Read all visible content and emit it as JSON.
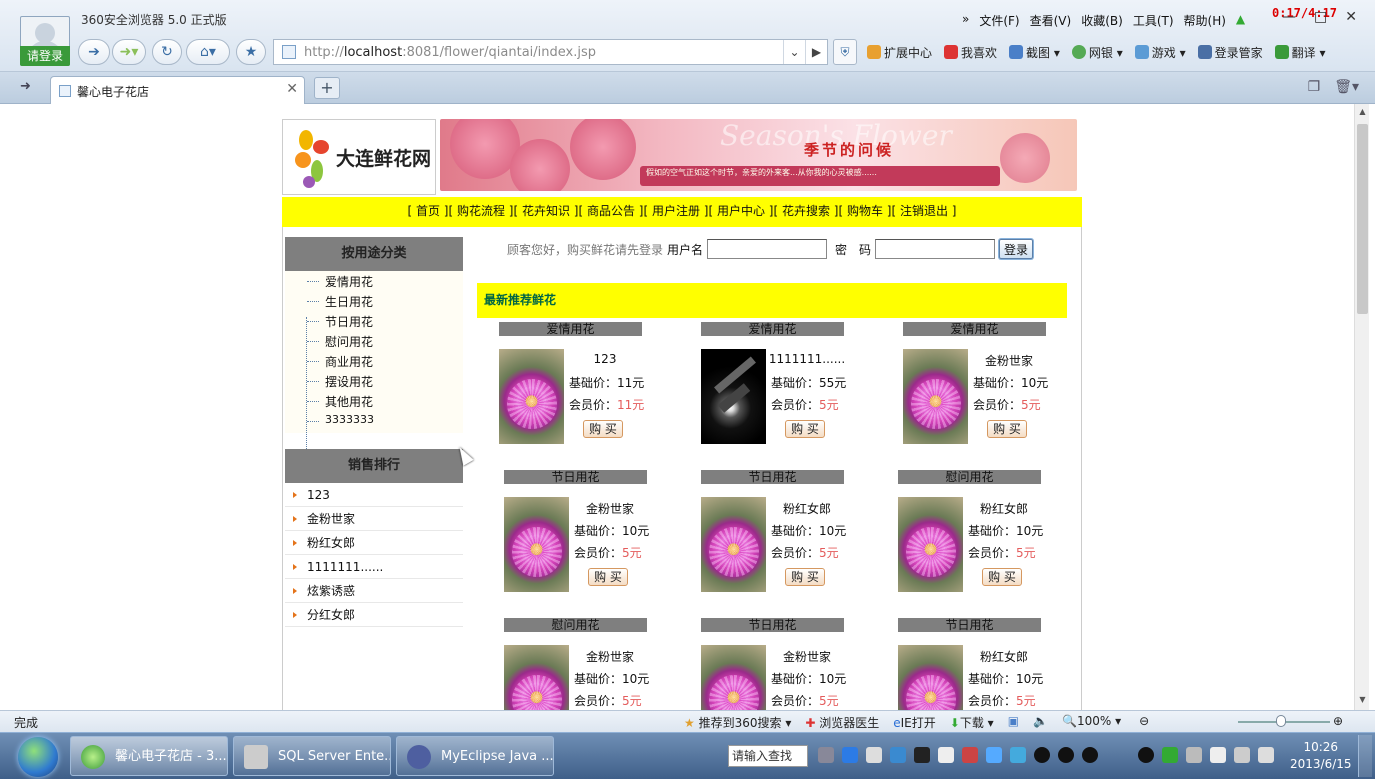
{
  "browser": {
    "app_title": "360安全浏览器 5.0 正式版",
    "login_label": "请登录",
    "timer": "0:17/4:17",
    "menu": [
      "»",
      "文件(F)",
      "查看(V)",
      "收藏(B)",
      "工具(T)",
      "帮助(H)"
    ],
    "url_host": "http://",
    "url_bold": "localhost",
    "url_rest": ":8081/flower/qiantai/index.jsp",
    "toolbar": [
      "扩展中心",
      "我喜欢",
      "截图",
      "网银",
      "游戏",
      "登录管家",
      "翻译"
    ],
    "tab_title": "馨心电子花店",
    "status_text": "完成",
    "status_tools": [
      "推荐到360搜索",
      "浏览器医生",
      "IE打开",
      "下载",
      "100%"
    ]
  },
  "site": {
    "logo_text": "大连鲜花网",
    "banner_slogan": "季节的问候",
    "banner_bg_text": "Season's Flower",
    "banner_strip": "假如的空气正如这个时节，亲爱的外来客...从你我的心灵被感......",
    "nav": [
      "[ 首页 ]",
      "[ 购花流程 ]",
      "[ 花卉知识 ]",
      "[ 商品公告 ]",
      "[ 用户注册 ]",
      "[ 用户中心 ]",
      "[ 花卉搜索 ]",
      "[ 购物车 ]",
      "[ 注销退出 ]"
    ],
    "sidebar": {
      "category_title": "按用途分类",
      "categories": [
        "爱情用花",
        "生日用花",
        "节日用花",
        "慰问用花",
        "商业用花",
        "摆设用花",
        "其他用花",
        "3333333"
      ],
      "rank_title": "销售排行",
      "ranking": [
        "123",
        "金粉世家",
        "粉红女郎",
        "1111111......",
        "炫紫诱惑",
        "分红女郎"
      ]
    },
    "login": {
      "prompt": "顾客您好，购买鲜花请先登录",
      "user_label": "用户名",
      "pwd_label": "密　码",
      "submit": "登录"
    },
    "section_title": "最新推荐鲜花",
    "labels": {
      "base": "基础价：",
      "member": "会员价：",
      "buy": "购 买"
    },
    "products": [
      {
        "cat": "爱情用花",
        "name": "123",
        "base": "11元",
        "member": "11元",
        "img": "flower"
      },
      {
        "cat": "爱情用花",
        "name": "1111111......",
        "base": "55元",
        "member": "5元",
        "img": "gun"
      },
      {
        "cat": "爱情用花",
        "name": "金粉世家",
        "base": "10元",
        "member": "5元",
        "img": "flower"
      },
      {
        "cat": "节日用花",
        "name": "金粉世家",
        "base": "10元",
        "member": "5元",
        "img": "flower"
      },
      {
        "cat": "节日用花",
        "name": "粉红女郎",
        "base": "10元",
        "member": "5元",
        "img": "flower"
      },
      {
        "cat": "慰问用花",
        "name": "粉红女郎",
        "base": "10元",
        "member": "5元",
        "img": "flower"
      },
      {
        "cat": "慰问用花",
        "name": "金粉世家",
        "base": "10元",
        "member": "5元",
        "img": "flower"
      },
      {
        "cat": "节日用花",
        "name": "金粉世家",
        "base": "10元",
        "member": "5元",
        "img": "flower"
      },
      {
        "cat": "节日用花",
        "name": "粉红女郎",
        "base": "10元",
        "member": "5元",
        "img": "flower"
      }
    ]
  },
  "taskbar": {
    "tasks": [
      "馨心电子花店 - 3...",
      "SQL Server Ente...",
      "MyEclipse Java ..."
    ],
    "search_placeholder": "请输入查找",
    "time": "10:26",
    "date": "2013/6/15"
  }
}
